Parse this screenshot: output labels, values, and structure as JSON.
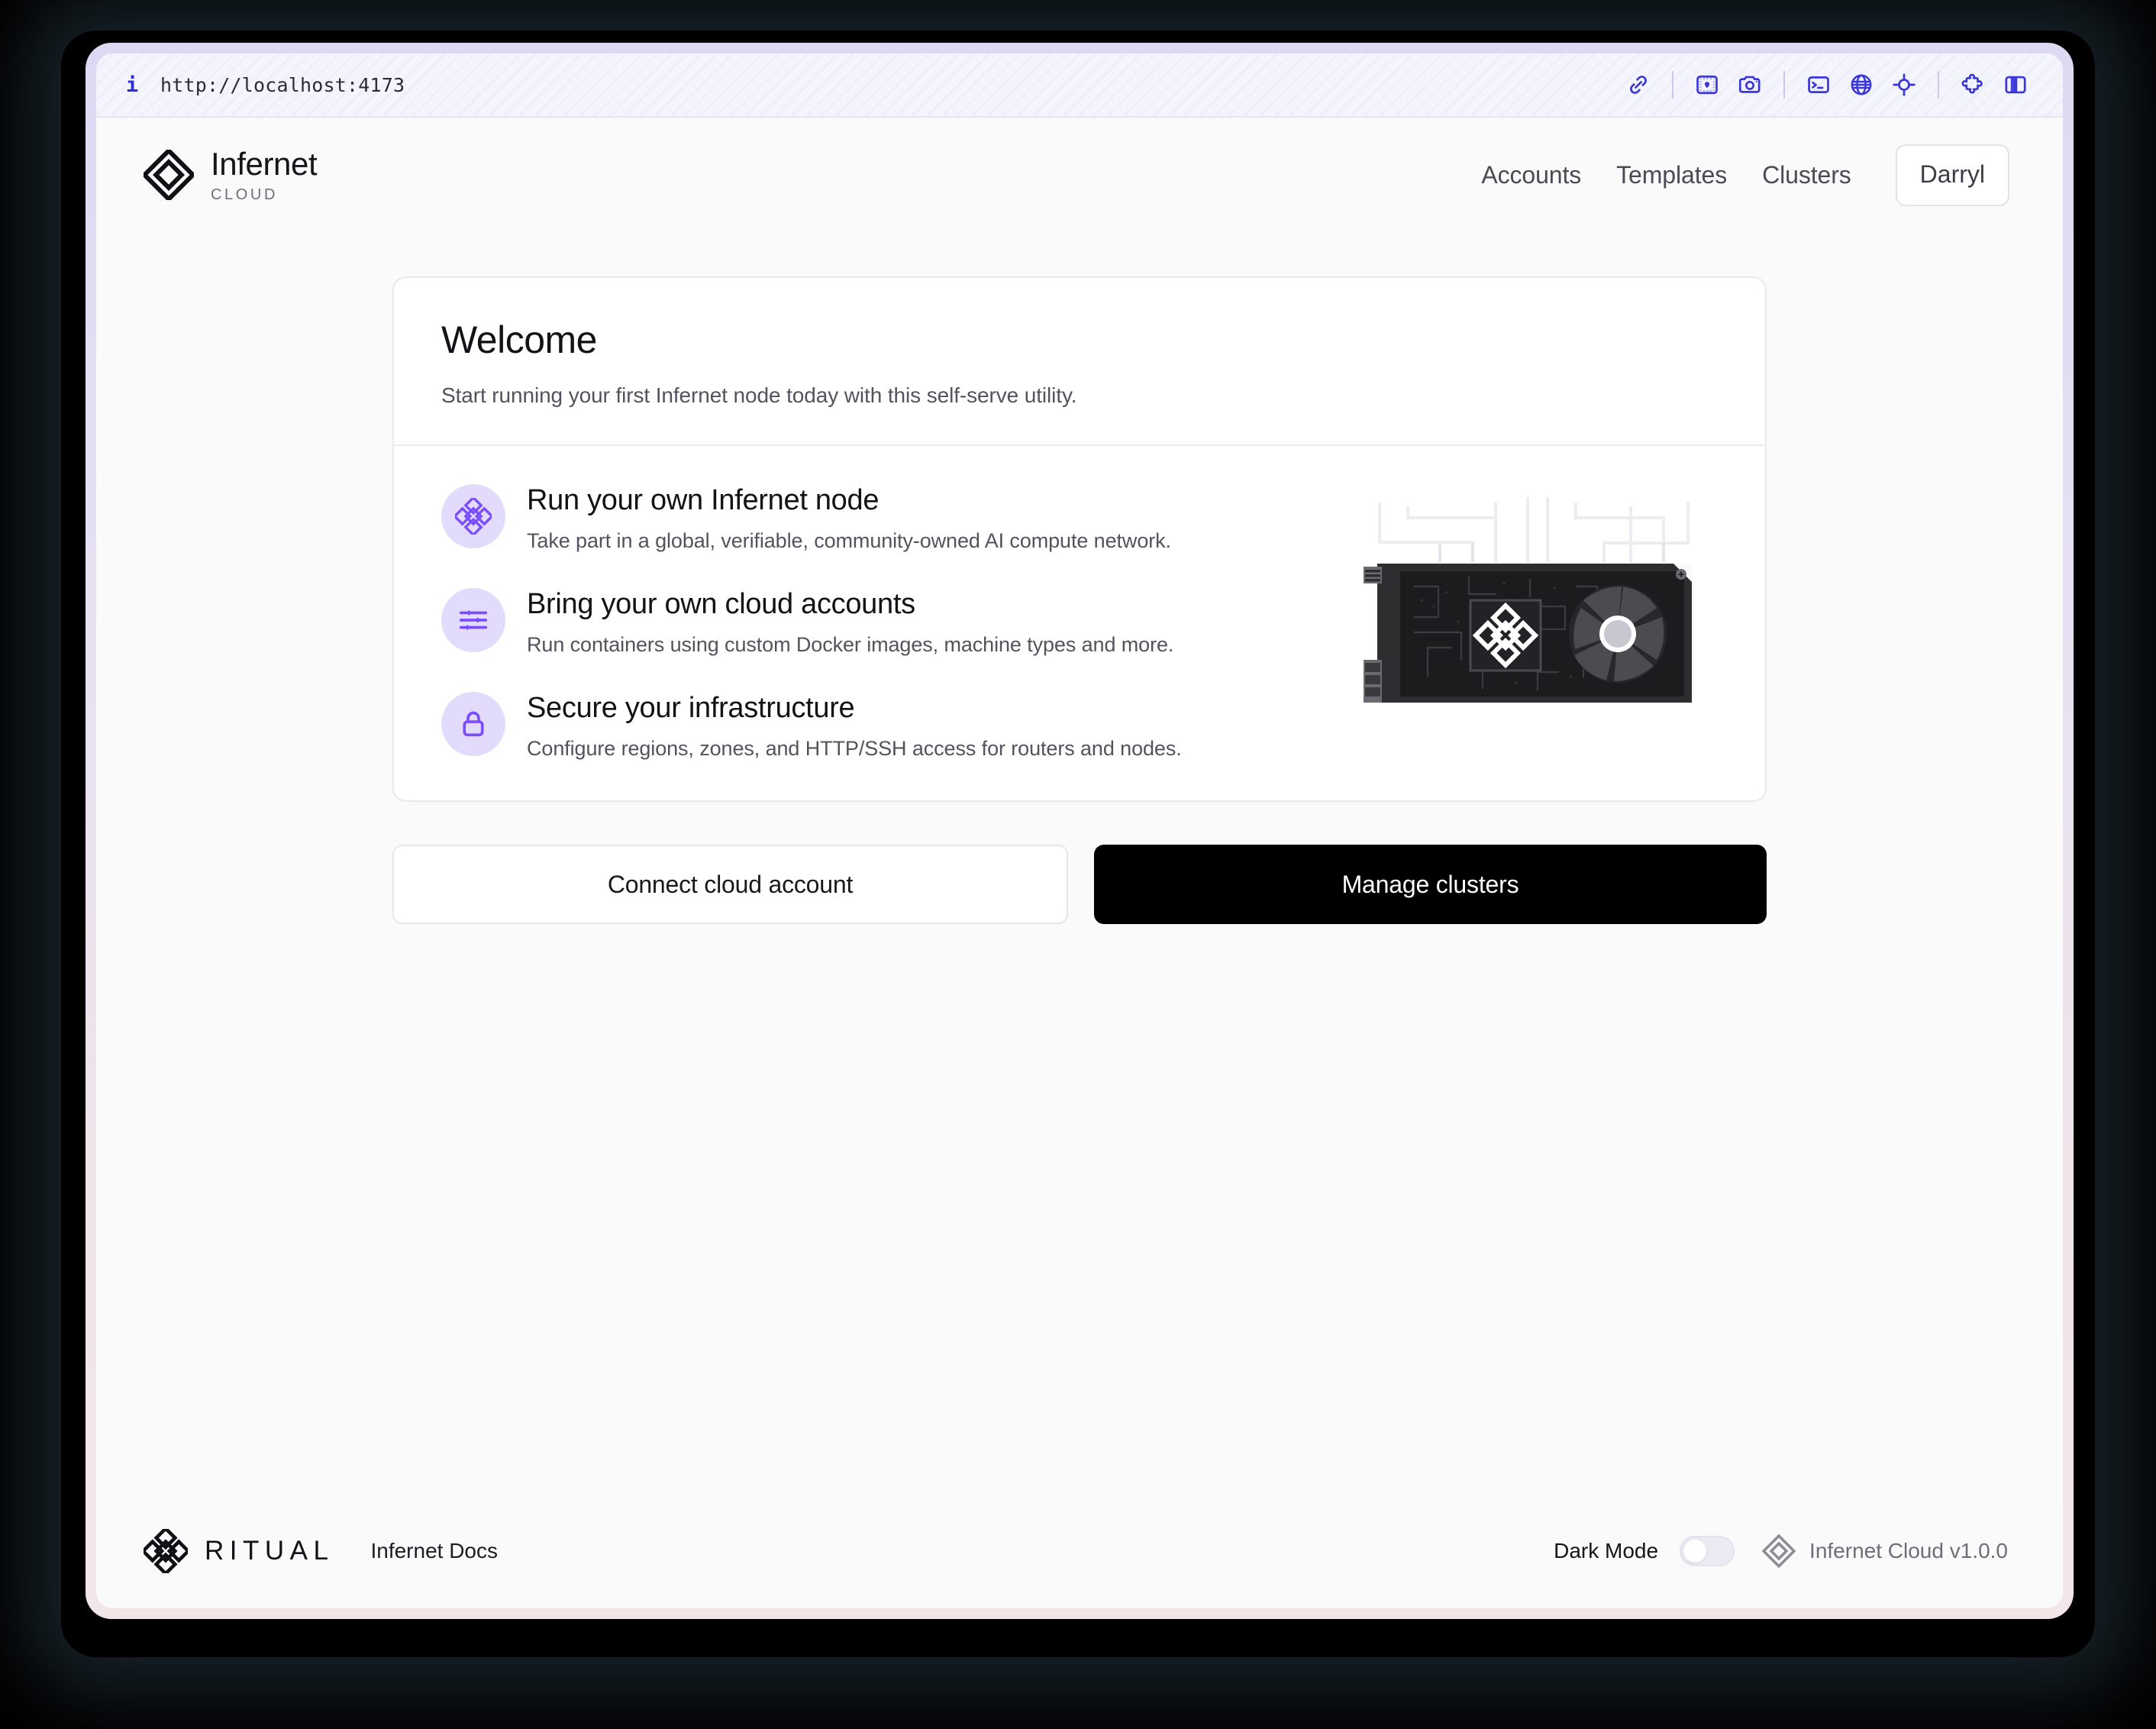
{
  "browser": {
    "info_icon": "info-icon",
    "url": "http://localhost:4173",
    "toolbar_icons": [
      "link-icon",
      "image-icon",
      "camera-icon",
      "terminal-icon",
      "globe-icon",
      "crosshair-icon",
      "puzzle-icon",
      "split-panel-icon"
    ]
  },
  "header": {
    "logo_icon": "infernet-knot-logo",
    "brand_name": "Infernet",
    "brand_sub": "CLOUD",
    "nav": [
      {
        "label": "Accounts"
      },
      {
        "label": "Templates"
      },
      {
        "label": "Clusters"
      }
    ],
    "user_button": "Darryl"
  },
  "card": {
    "title": "Welcome",
    "subtitle": "Start running your first Infernet node today with this self-serve utility.",
    "features": [
      {
        "icon": "ritual-knot-icon",
        "title": "Run your own Infernet node",
        "desc": "Take part in a global, verifiable, community-owned AI compute network."
      },
      {
        "icon": "sliders-icon",
        "title": "Bring your own cloud accounts",
        "desc": "Run containers using custom Docker images, machine types and more."
      },
      {
        "icon": "lock-icon",
        "title": "Secure your infrastructure",
        "desc": "Configure regions, zones, and HTTP/SSH access for routers and nodes."
      }
    ],
    "illustration": "gpu-card-illustration"
  },
  "actions": {
    "secondary": "Connect cloud account",
    "primary": "Manage clusters"
  },
  "footer": {
    "ritual_logo_icon": "ritual-knot-logo",
    "ritual_word": "RITUAL",
    "docs_link": "Infernet Docs",
    "dark_mode_label": "Dark Mode",
    "dark_mode_on": false,
    "version_icon": "infernet-diamond-icon",
    "version": "Infernet Cloud v1.0.0"
  },
  "colors": {
    "accent_purple": "#7c4dff",
    "icon_bg": "#e2dbfb",
    "toolbar_blue": "#3a37d8",
    "primary_button": "#000000",
    "page_bg": "#fafafb"
  }
}
